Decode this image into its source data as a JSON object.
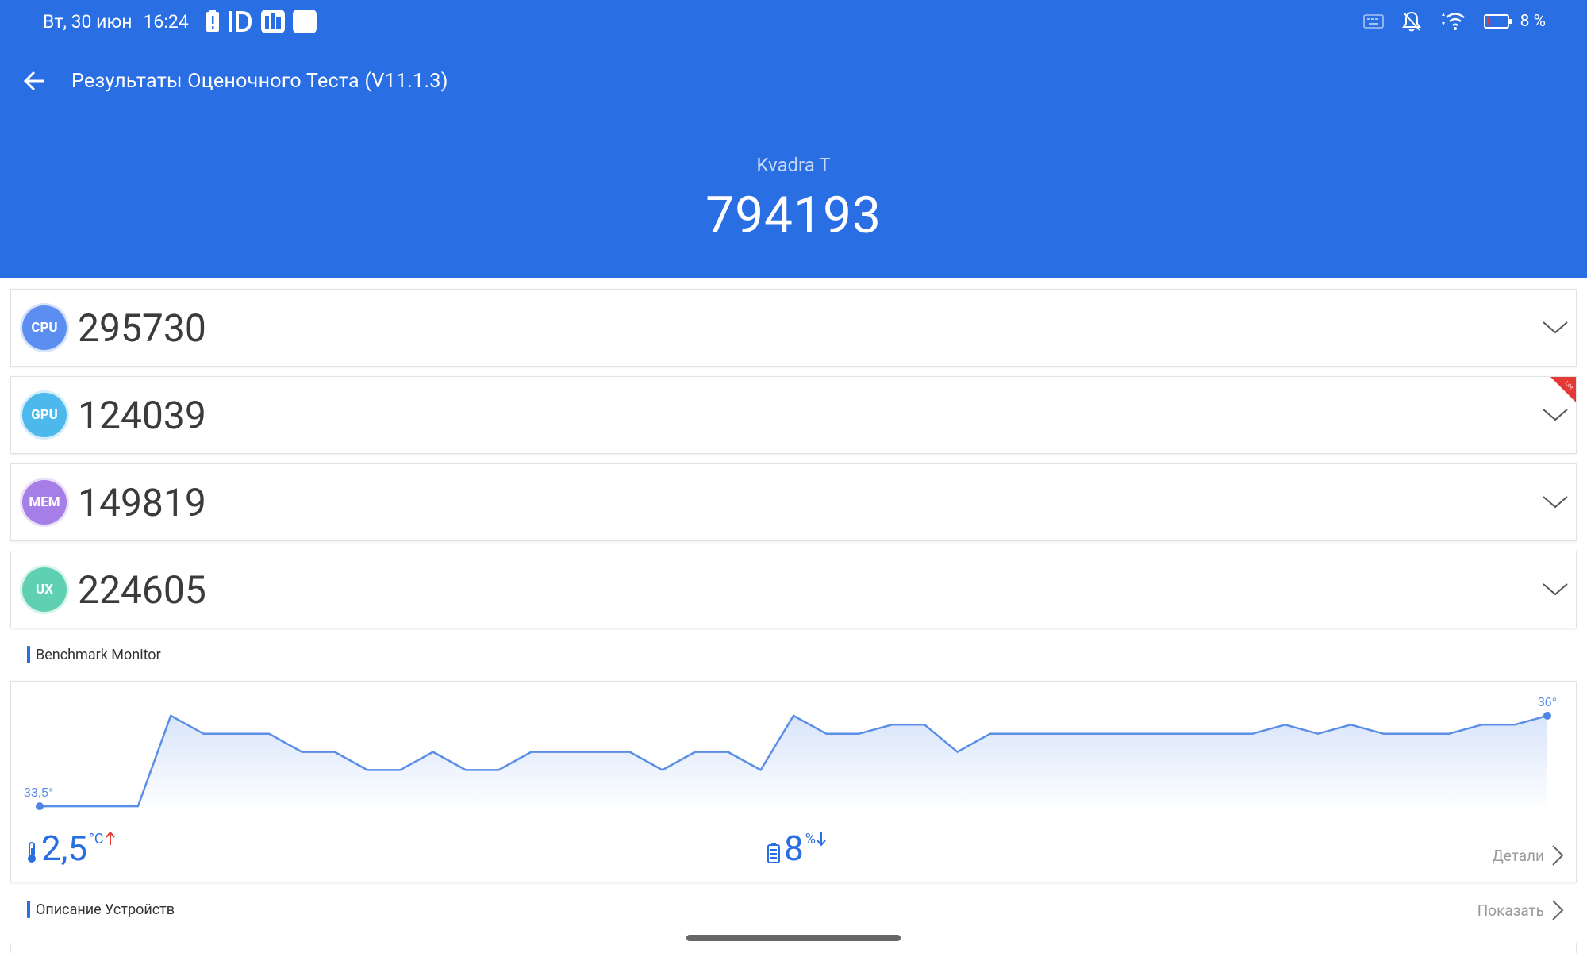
{
  "status_bar": {
    "date": "Вт, 30 июн",
    "time": "16:24",
    "battery_percent": "8 %",
    "icons_left": [
      "battery-alert-icon",
      "id-icon",
      "app-icon",
      "square-app-icon"
    ],
    "icons_right": [
      "keyboard-icon",
      "notifications-off-icon",
      "wifi-icon",
      "battery-icon"
    ]
  },
  "app_bar": {
    "title": "Результаты Оценочного Теста (V11.1.3)",
    "back_icon": "arrow-back-icon"
  },
  "result": {
    "device_name": "Kvadra T",
    "total_score": "794193"
  },
  "scores": [
    {
      "badge": "CPU",
      "value": "295730",
      "color": "#5b8ef0",
      "lite": false
    },
    {
      "badge": "GPU",
      "value": "124039",
      "color": "#4cb8ec",
      "lite": true
    },
    {
      "badge": "MEM",
      "value": "149819",
      "color": "#a67ee8",
      "lite": false
    },
    {
      "badge": "UX",
      "value": "224605",
      "color": "#5fd1b2",
      "lite": false
    }
  ],
  "monitor": {
    "section_title": "Benchmark Monitor",
    "temp_change": "2,5",
    "temp_unit": "°C",
    "battery_change": "8",
    "battery_unit": "%",
    "details_label": "Детали",
    "colors": {
      "line": "#5b8ee6",
      "fill_top": "#dde8fa",
      "temp_up": "#e53935"
    }
  },
  "chart_data": {
    "type": "area",
    "title": "",
    "xlabel": "",
    "ylabel": "",
    "start_label": "33,5°",
    "end_label": "36°",
    "ylim": [
      33.0,
      36.5
    ],
    "y": [
      33.5,
      33.5,
      33.5,
      33.5,
      36.0,
      35.5,
      35.5,
      35.5,
      35.0,
      35.0,
      34.5,
      34.5,
      35.0,
      34.5,
      34.5,
      35.0,
      35.0,
      35.0,
      35.0,
      34.5,
      35.0,
      35.0,
      34.5,
      36.0,
      35.5,
      35.5,
      35.75,
      35.75,
      35.0,
      35.5,
      35.5,
      35.5,
      35.5,
      35.5,
      35.5,
      35.5,
      35.5,
      35.5,
      35.75,
      35.5,
      35.75,
      35.5,
      35.5,
      35.5,
      35.75,
      35.75,
      36.0
    ],
    "grid": false,
    "legend": "none"
  },
  "device_description": {
    "section_title": "Описание Устройств",
    "show_label": "Показать"
  },
  "lite_tag": "Lite"
}
